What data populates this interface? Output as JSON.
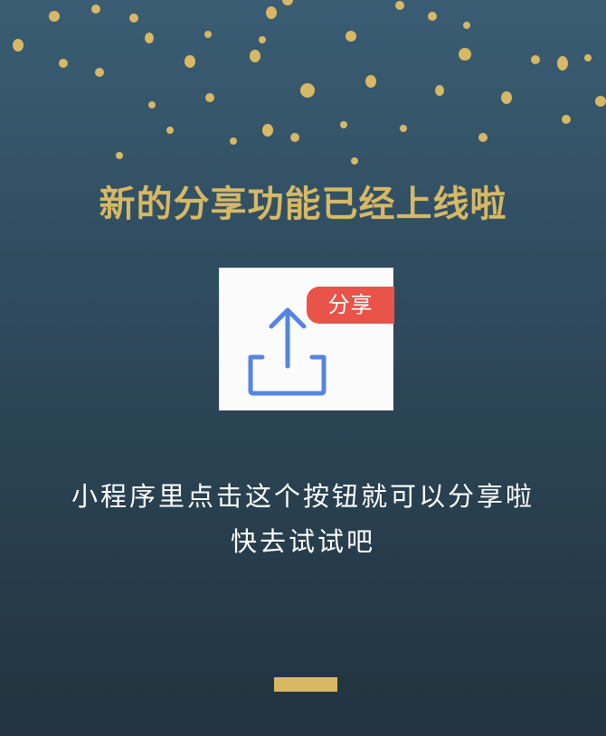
{
  "headline": "新的分享功能已经上线啦",
  "share_card": {
    "badge_label": "分享",
    "icon": "share-upload-icon"
  },
  "message": {
    "line1": "小程序里点击这个按钮就可以分享啦",
    "line2": "快去试试吧"
  },
  "colors": {
    "background_top": "#3a5d73",
    "background_bottom": "#22333f",
    "gold": "#d6b865",
    "icon_blue": "#5585e0",
    "badge_red": "#e8534a",
    "text": "#ffffff"
  }
}
